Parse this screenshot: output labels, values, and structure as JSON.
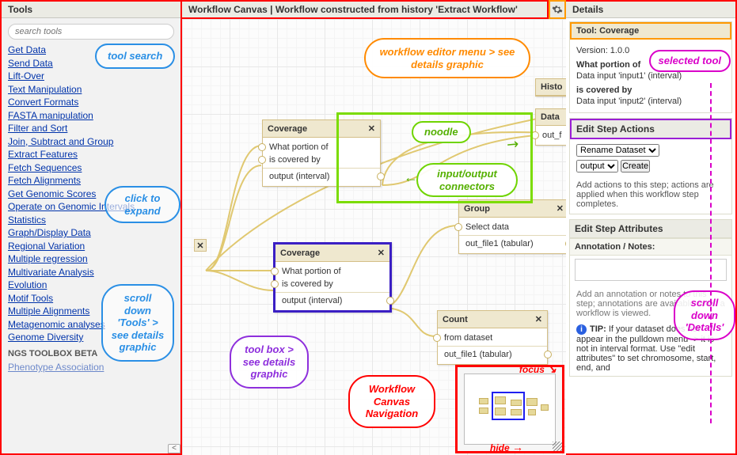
{
  "headers": {
    "tools": "Tools",
    "details": "Details",
    "canvas": "Workflow Canvas | Workflow constructed from history 'Extract Workflow'"
  },
  "search": {
    "placeholder": "search tools"
  },
  "tools": [
    "Get Data",
    "Send Data",
    "Lift-Over",
    "Text Manipulation",
    "Convert Formats",
    "FASTA manipulation",
    "Filter and Sort",
    "Join, Subtract and Group",
    "Extract Features",
    "Fetch Sequences",
    "Fetch Alignments",
    "Get Genomic Scores",
    "Operate on Genomic Intervals",
    "Statistics",
    "Graph/Display Data",
    "Regional Variation",
    "Multiple regression",
    "Multivariate Analysis",
    "Evolution",
    "Motif Tools",
    "Multiple Alignments",
    "Metagenomic analyses",
    "Genome Diversity"
  ],
  "toolbox_section": "NGS TOOLBOX BETA",
  "toolbox_item": "Phenotype Association",
  "collapse_glyph": "<",
  "nodes": {
    "cov1": {
      "title": "Coverage",
      "rows": [
        "What portion of",
        "is covered by",
        "output (interval)"
      ]
    },
    "cov2": {
      "title": "Coverage",
      "rows": [
        "What portion of",
        "is covered by",
        "output (interval)"
      ]
    },
    "group": {
      "title": "Group",
      "rows": [
        "Select data",
        "out_file1 (tabular)"
      ]
    },
    "count": {
      "title": "Count",
      "rows": [
        "from dataset",
        "out_file1 (tabular)"
      ]
    },
    "histo": {
      "title": "Histo"
    },
    "dataset": {
      "title": "Data",
      "row": "out_f"
    },
    "close_glyph": "✕",
    "mini_glyph": "✕"
  },
  "callouts": {
    "tool_search": "tool search",
    "click_expand": "click to expand",
    "scroll_tools": "scroll down 'Tools' > see details graphic",
    "editor_menu": "workflow editor menu > see details graphic",
    "noodle": "noodle",
    "connectors": "input/output connectors",
    "toolbox": "tool box > see details graphic",
    "nav": "Workflow Canvas Navigation",
    "focus": "focus",
    "hide": "hide",
    "selected_tool": "selected tool",
    "scroll_details": "scroll down 'Details'"
  },
  "details": {
    "tool_title": "Tool: Coverage",
    "version_lbl": "Version: 1.0.0",
    "in1_lbl": "What portion of",
    "in1_val": "Data input 'input1' (interval)",
    "in2_lbl": "is covered by",
    "in2_val": "Data input 'input2' (interval)",
    "actions_title": "Edit Step Actions",
    "action_select": "Rename Dataset",
    "action_target": "output",
    "create_btn": "Create",
    "actions_note": "Add actions to this step; actions are applied when this workflow step completes.",
    "attr_title": "Edit Step Attributes",
    "annot_title": "Annotation / Notes:",
    "annot_note": "Add an annotation or notes to this step; annotations are available when a workflow is viewed.",
    "tip_label": "TIP:",
    "tip_text": "If your dataset does not appear in the pulldown menu -> it is not in interval format. Use \"edit attributes\" to set chromosome, start, end, and"
  }
}
